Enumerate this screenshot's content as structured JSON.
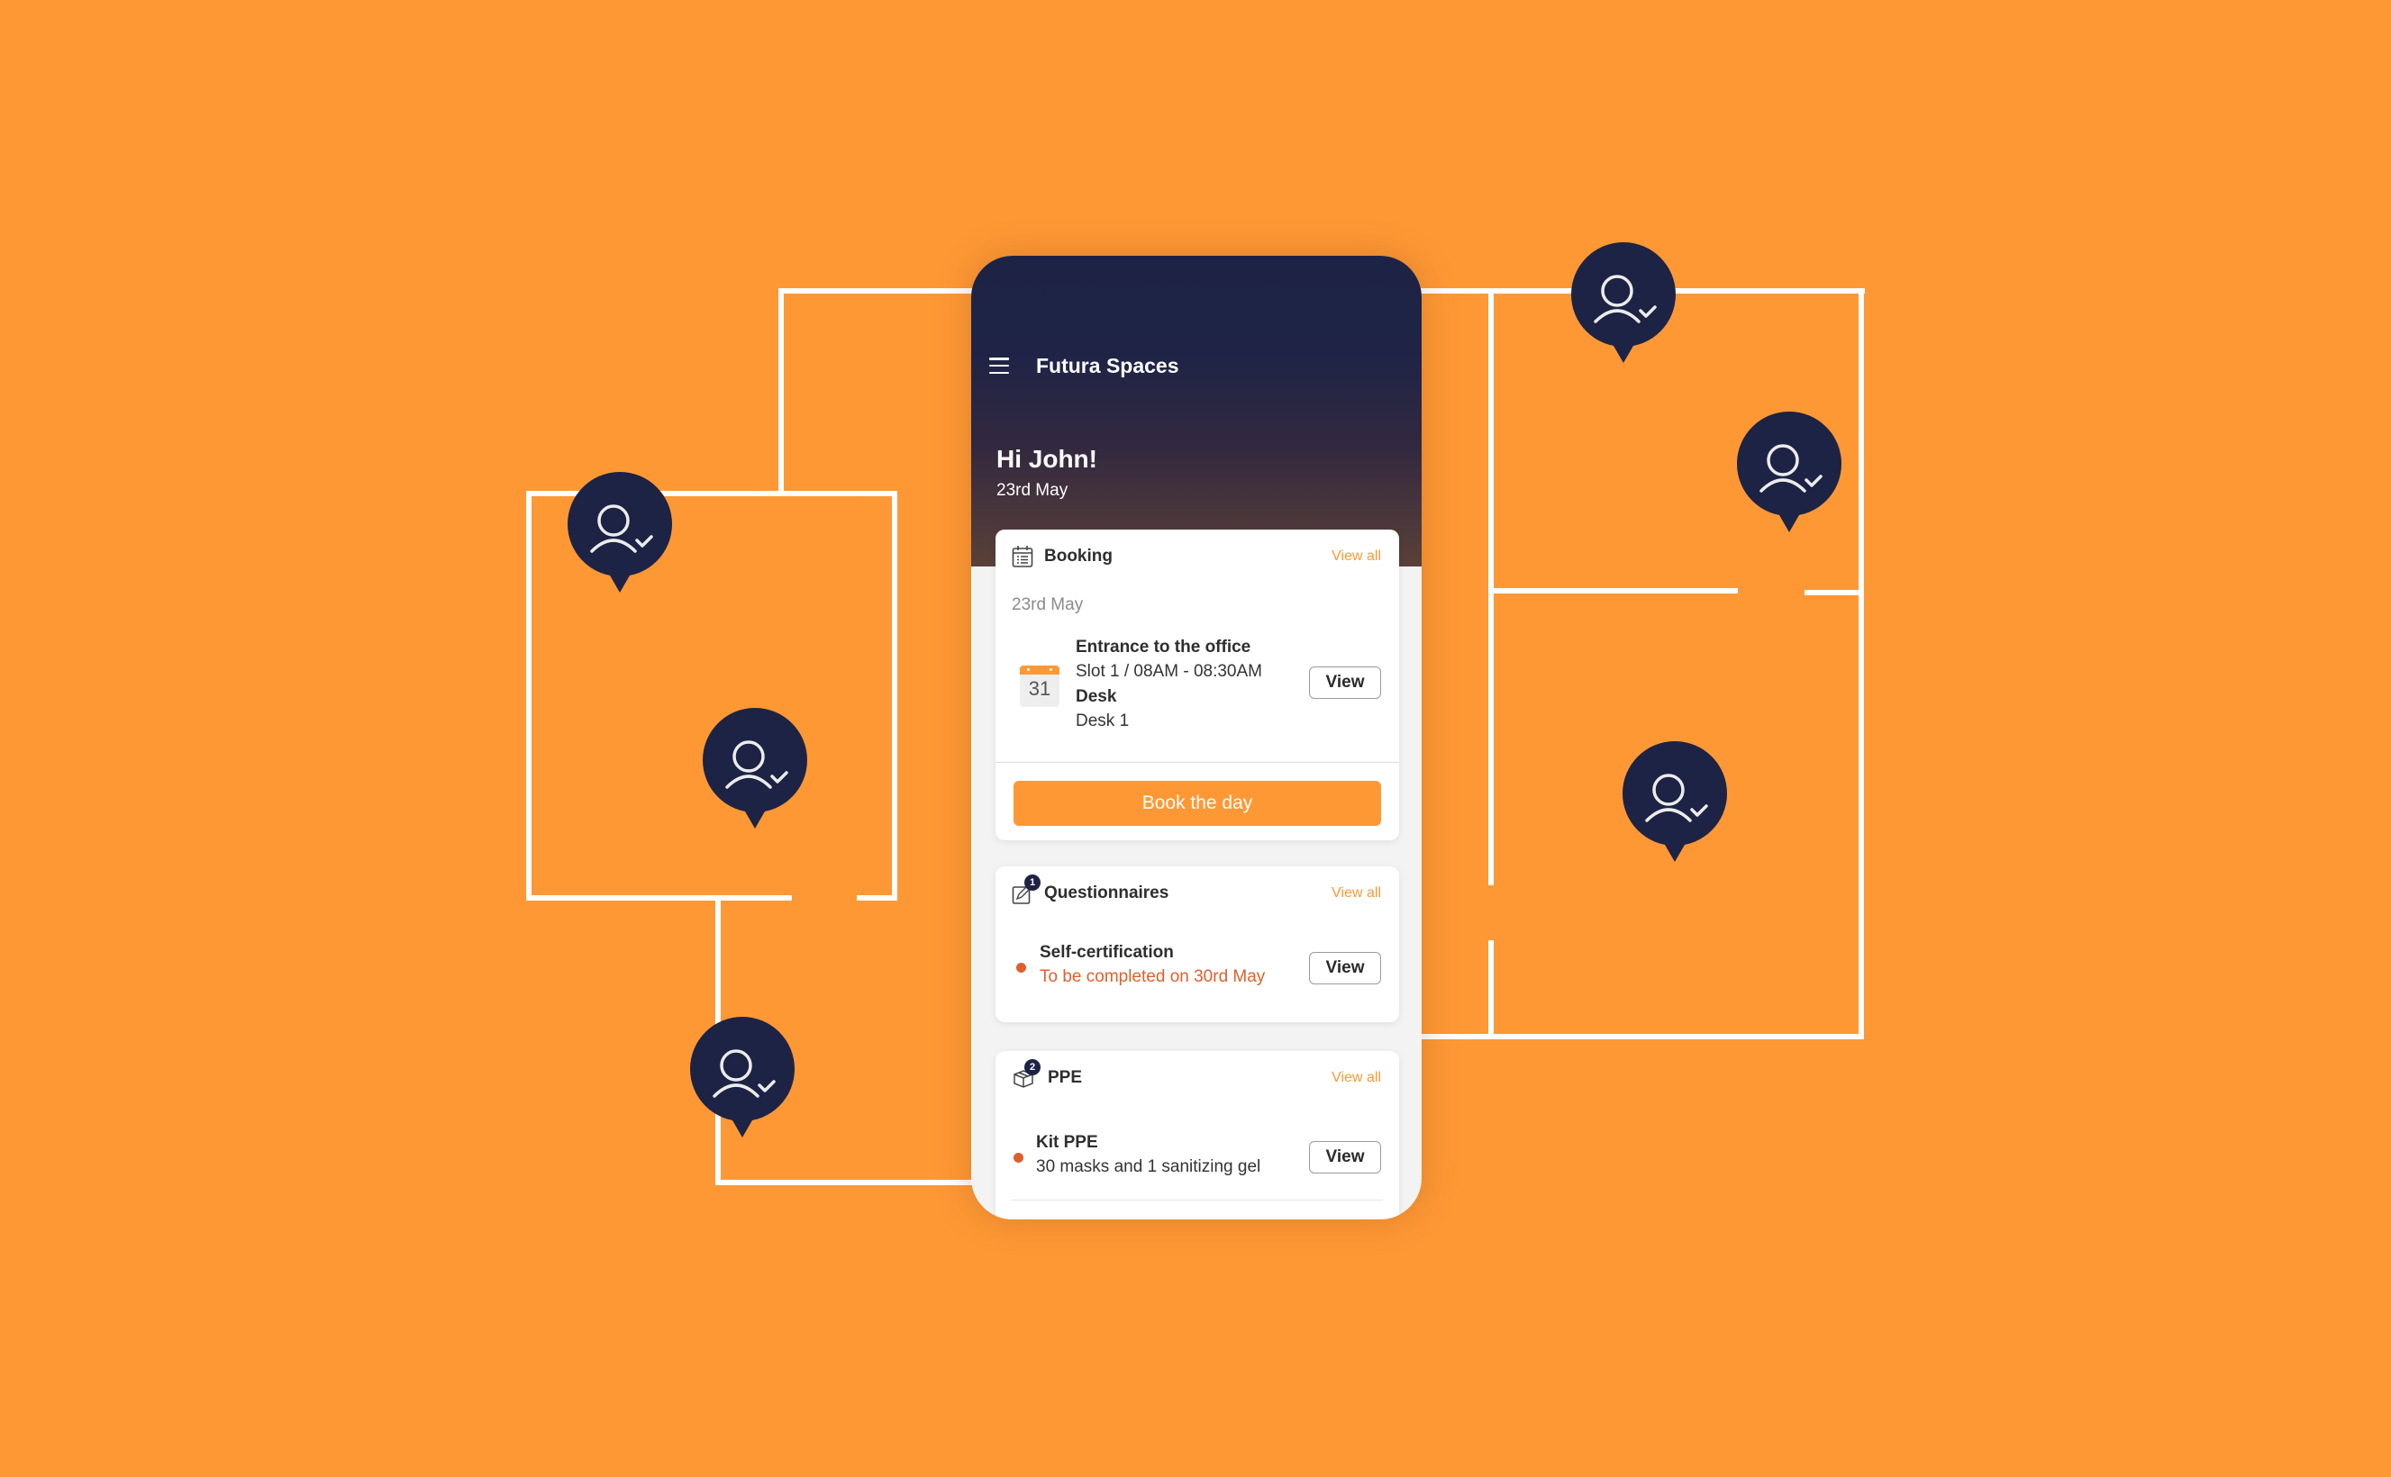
{
  "app": {
    "title": "Futura Spaces",
    "menu_icon": "hamburger-menu-icon"
  },
  "greeting": {
    "text": "Hi John!",
    "date": "23rd May"
  },
  "booking": {
    "title": "Booking",
    "icon": "calendar-list-icon",
    "view_all": "View all",
    "date": "23rd May",
    "item": {
      "icon": "calendar-31-icon",
      "calendar_day": "31",
      "title": "Entrance to the office",
      "slot": "Slot 1 / 08AM - 08:30AM",
      "resource_label": "Desk",
      "resource_value": "Desk 1",
      "action": "View"
    },
    "cta": "Book the day"
  },
  "questionnaires": {
    "title": "Questionnaires",
    "icon": "edit-note-icon",
    "badge": "1",
    "view_all": "View all",
    "item": {
      "title": "Self-certification",
      "status": "To be completed on 30rd May",
      "action": "View"
    }
  },
  "ppe": {
    "title": "PPE",
    "icon": "package-box-icon",
    "badge": "2",
    "view_all": "View all",
    "item": {
      "title": "Kit PPE",
      "description": "30 masks and 1 sanitizing gel",
      "action": "View"
    }
  },
  "colors": {
    "background": "#FE9835",
    "navy": "#1D2345",
    "accent_orange": "#FE9835",
    "status_red": "#E05E2A"
  },
  "map_pins": [
    {
      "icon": "user-check-icon"
    },
    {
      "icon": "user-check-icon"
    },
    {
      "icon": "user-check-icon"
    },
    {
      "icon": "user-check-icon"
    },
    {
      "icon": "user-check-icon"
    },
    {
      "icon": "user-check-icon"
    }
  ]
}
